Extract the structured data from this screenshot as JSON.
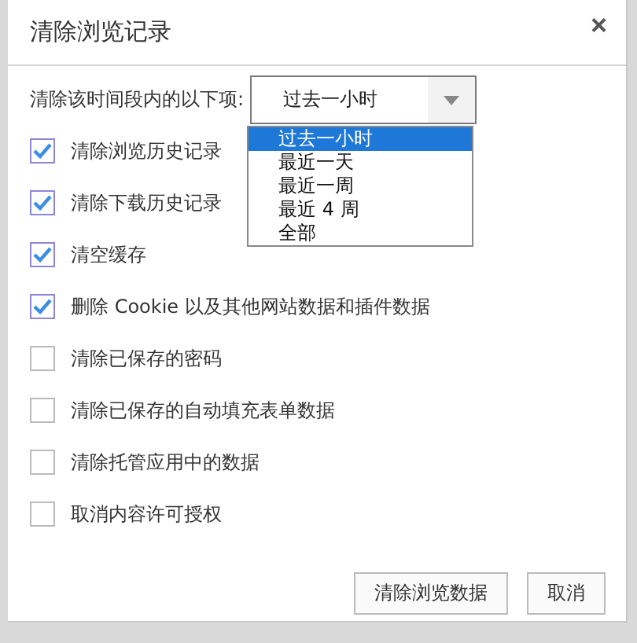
{
  "dialog": {
    "title": "清除浏览记录",
    "close": "×"
  },
  "range": {
    "label": "清除该时间段内的以下项:",
    "value": "过去一小时",
    "expanded": true,
    "options": [
      {
        "label": "过去一小时",
        "selected": true
      },
      {
        "label": "最近一天",
        "selected": false
      },
      {
        "label": "最近一周",
        "selected": false
      },
      {
        "label": "最近 4 周",
        "selected": false
      },
      {
        "label": "全部",
        "selected": false
      }
    ]
  },
  "items": [
    {
      "label": "清除浏览历史记录",
      "checked": true
    },
    {
      "label": "清除下载历史记录",
      "checked": true
    },
    {
      "label": "清空缓存",
      "checked": true
    },
    {
      "label": "删除 Cookie 以及其他网站数据和插件数据",
      "checked": true
    },
    {
      "label": "清除已保存的密码",
      "checked": false
    },
    {
      "label": "清除已保存的自动填充表单数据",
      "checked": false
    },
    {
      "label": "清除托管应用中的数据",
      "checked": false
    },
    {
      "label": "取消内容许可授权",
      "checked": false
    }
  ],
  "buttons": [
    "清除浏览数据",
    "取消"
  ]
}
